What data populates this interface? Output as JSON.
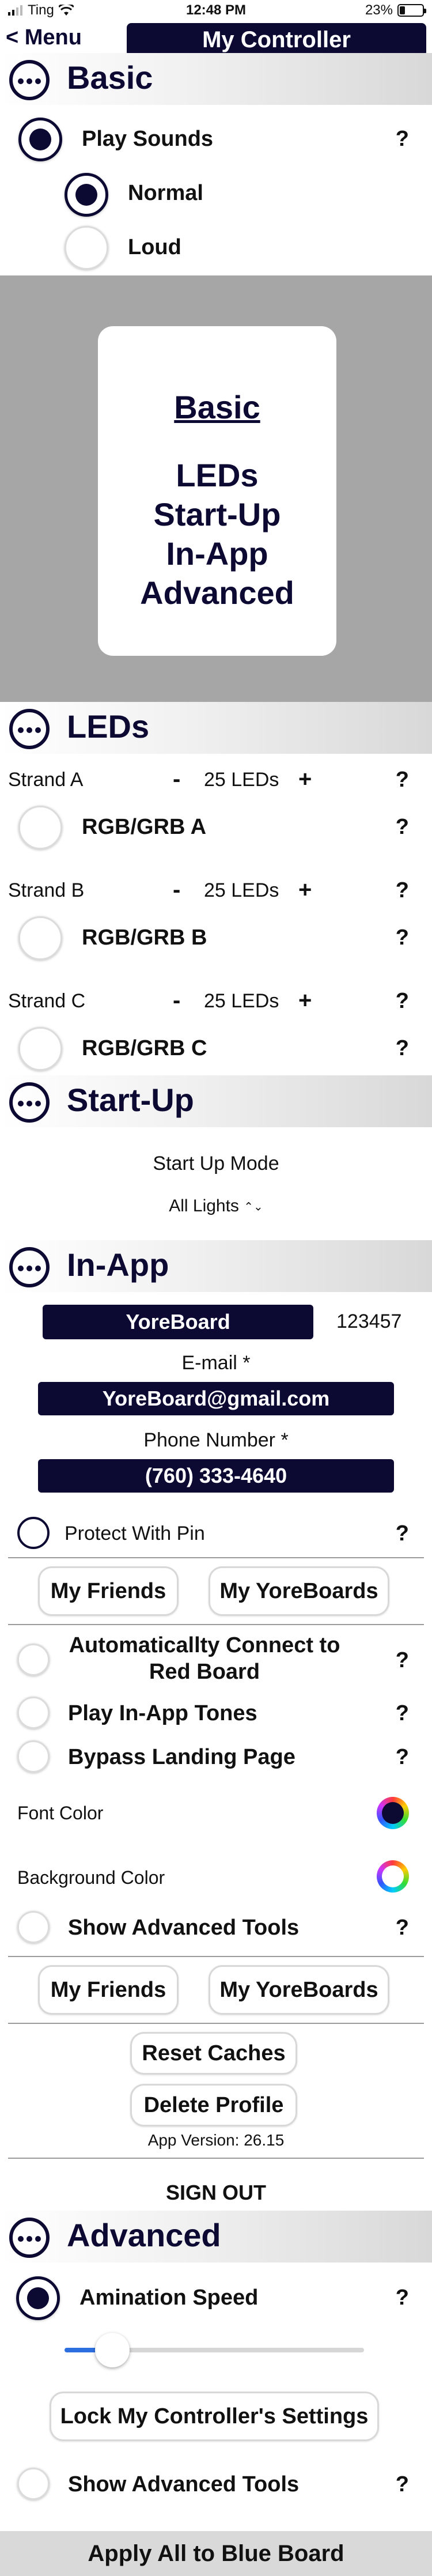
{
  "status_bar": {
    "carrier": "Ting",
    "time": "12:48 PM",
    "battery": "23%",
    "battery_level": 0.23
  },
  "nav": {
    "back_label": "< Menu",
    "title": "My Controller"
  },
  "basic": {
    "title": "Basic",
    "play_sounds": {
      "label": "Play Sounds",
      "help": "?",
      "checked": true
    },
    "options": [
      {
        "label": "Normal",
        "checked": true
      },
      {
        "label": "Loud",
        "checked": false
      }
    ]
  },
  "banner": {
    "title": "Basic",
    "items": [
      "LEDs",
      "Start-Up",
      "In-App",
      "Advanced"
    ]
  },
  "leds": {
    "title": "LEDs",
    "strands": [
      {
        "name": "Strand A",
        "minus": "-",
        "count": "25 LEDs",
        "plus": "+",
        "help": "?",
        "mode": "RGB/GRB A",
        "mode_help": "?"
      },
      {
        "name": "Strand B",
        "minus": "-",
        "count": "25 LEDs",
        "plus": "+",
        "help": "?",
        "mode": "RGB/GRB B",
        "mode_help": "?"
      },
      {
        "name": "Strand C",
        "minus": "-",
        "count": "25 LEDs",
        "plus": "+",
        "help": "?",
        "mode": "RGB/GRB C",
        "mode_help": "?"
      }
    ]
  },
  "startup": {
    "title": "Start-Up",
    "mode_label": "Start Up Mode",
    "mode_value": "All Lights",
    "chevron": "⌃⌄"
  },
  "inapp": {
    "title": "In-App",
    "board_name": "YoreBoard",
    "board_id": "123457",
    "email_label": "E-mail *",
    "email_value": "YoreBoard@gmail.com",
    "phone_label": "Phone Number *",
    "phone_value": "(760) 333-4640",
    "protect_pin": {
      "label": "Protect With Pin",
      "help": "?"
    },
    "btn_friends": "My Friends",
    "btn_yoreboards": "My YoreBoards",
    "auto_connect": {
      "label_line1": "Automaticallty Connect to",
      "label_line2": "Red Board",
      "help": "?"
    },
    "play_tones": {
      "label": "Play In-App Tones",
      "help": "?"
    },
    "bypass": {
      "label": "Bypass Landing Page",
      "help": "?"
    },
    "font_color": {
      "label": "Font Color",
      "value": "#0c0a33"
    },
    "bg_color": {
      "label": "Background Color",
      "value": "#ffffff"
    },
    "show_tools": {
      "label": "Show Advanced Tools",
      "help": "?"
    },
    "btn_friends2": "My Friends",
    "btn_yoreboards2": "My YoreBoards",
    "reset_caches": "Reset Caches",
    "delete_profile": "Delete Profile",
    "app_version": "App Version: 26.15",
    "sign_out": "SIGN OUT"
  },
  "advanced": {
    "title": "Advanced",
    "animation_speed": {
      "label": "Amination Speed",
      "help": "?",
      "checked": true,
      "value": 0.16
    },
    "lock_btn": "Lock My Controller's Settings",
    "show_tools": {
      "label": "Show Advanced Tools",
      "help": "?"
    }
  },
  "apply_button": "Apply All to Blue Board",
  "colors": {
    "navy": "#0c0a33",
    "banner_grey": "#a6a6a6",
    "slider_blue": "#2e6fe0"
  }
}
